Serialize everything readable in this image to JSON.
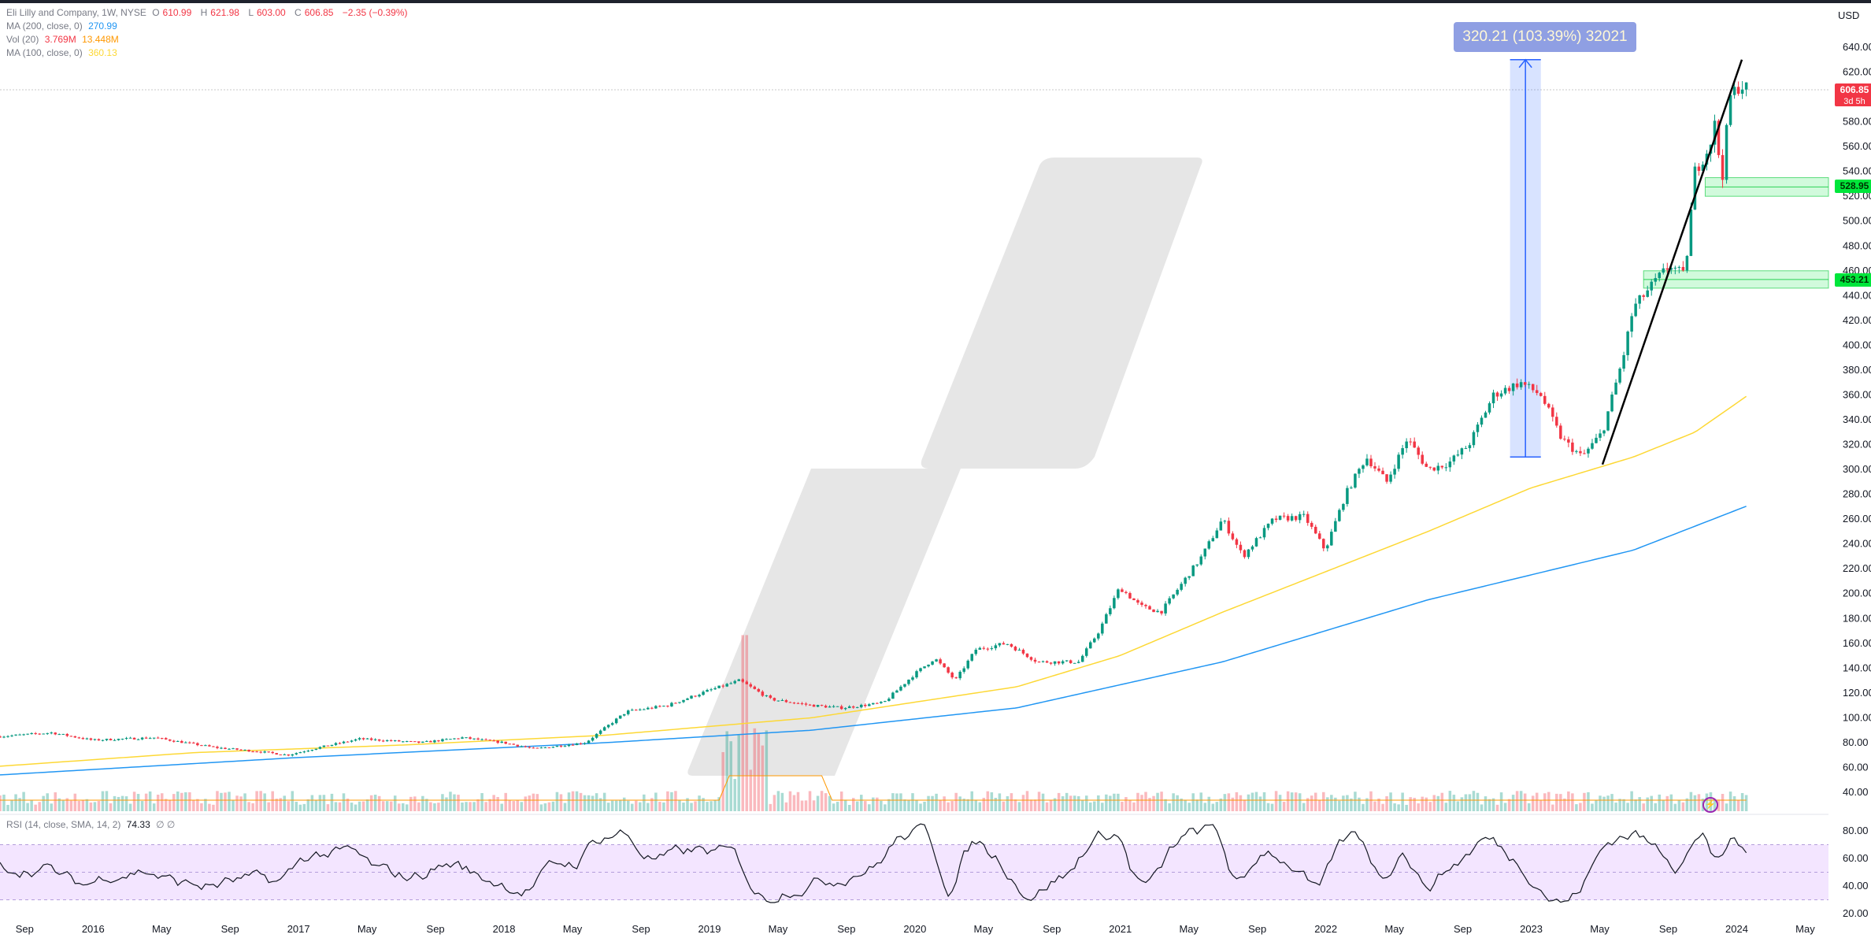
{
  "header": {
    "symbol": "Eli Lilly and Company, 1W, NYSE",
    "open_label": "O",
    "open": "610.99",
    "high_label": "H",
    "high": "621.98",
    "low_label": "L",
    "low": "603.00",
    "close_label": "C",
    "close": "606.85",
    "change": "−2.35 (−0.39%)"
  },
  "indicators": {
    "ma200": {
      "label": "MA (200, close, 0)",
      "value": "270.99",
      "color": "#2196f3"
    },
    "vol": {
      "label": "Vol (20)",
      "value": "3.769M",
      "ma_value": "13.448M"
    },
    "ma100": {
      "label": "MA (100, close, 0)",
      "value": "360.13",
      "color": "#fdd835"
    },
    "rsi": {
      "label": "RSI (14, close, SMA, 14, 2)",
      "value": "74.33",
      "extra": "∅ ∅"
    }
  },
  "currency": "USD",
  "measure": {
    "label": "320.21 (103.39%) 32021"
  },
  "tags": {
    "last": {
      "price": "606.85",
      "countdown": "3d 5h"
    },
    "support1": "528.95",
    "support2": "453.21"
  },
  "chart_data": {
    "type": "candlestick",
    "title": "",
    "price_axis": {
      "ticks": [
        40,
        60,
        80,
        100,
        120,
        140,
        160,
        180,
        200,
        220,
        240,
        260,
        280,
        300,
        320,
        340,
        360,
        380,
        400,
        420,
        440,
        460,
        480,
        500,
        520,
        540,
        560,
        580,
        600,
        620,
        640
      ],
      "range": [
        30,
        650
      ]
    },
    "rsi_axis": {
      "ticks": [
        20,
        40,
        60,
        80
      ],
      "upper_band": 70,
      "lower_band": 30
    },
    "time_axis": {
      "labels": [
        "Sep",
        "2016",
        "May",
        "Sep",
        "2017",
        "May",
        "Sep",
        "2018",
        "May",
        "Sep",
        "2019",
        "May",
        "Sep",
        "2020",
        "May",
        "Sep",
        "2021",
        "May",
        "Sep",
        "2022",
        "May",
        "Sep",
        "2023",
        "May",
        "Sep",
        "2024",
        "May"
      ],
      "range": [
        2015.55,
        2024.45
      ]
    },
    "price_path": [
      [
        2015.55,
        85
      ],
      [
        2015.8,
        88
      ],
      [
        2016.0,
        82
      ],
      [
        2016.3,
        84
      ],
      [
        2016.6,
        76
      ],
      [
        2016.8,
        73
      ],
      [
        2016.95,
        70
      ],
      [
        2017.1,
        76
      ],
      [
        2017.3,
        83
      ],
      [
        2017.6,
        80
      ],
      [
        2017.8,
        84
      ],
      [
        2018.0,
        80
      ],
      [
        2018.15,
        75
      ],
      [
        2018.4,
        80
      ],
      [
        2018.6,
        105
      ],
      [
        2018.8,
        110
      ],
      [
        2019.0,
        122
      ],
      [
        2019.15,
        130
      ],
      [
        2019.3,
        115
      ],
      [
        2019.5,
        110
      ],
      [
        2019.65,
        108
      ],
      [
        2019.85,
        112
      ],
      [
        2020.0,
        135
      ],
      [
        2020.1,
        148
      ],
      [
        2020.2,
        130
      ],
      [
        2020.3,
        155
      ],
      [
        2020.45,
        160
      ],
      [
        2020.6,
        145
      ],
      [
        2020.8,
        145
      ],
      [
        2020.9,
        170
      ],
      [
        2021.0,
        205
      ],
      [
        2021.1,
        190
      ],
      [
        2021.2,
        185
      ],
      [
        2021.4,
        230
      ],
      [
        2021.5,
        260
      ],
      [
        2021.6,
        230
      ],
      [
        2021.75,
        260
      ],
      [
        2021.9,
        262
      ],
      [
        2022.0,
        235
      ],
      [
        2022.1,
        280
      ],
      [
        2022.2,
        310
      ],
      [
        2022.3,
        290
      ],
      [
        2022.4,
        325
      ],
      [
        2022.5,
        300
      ],
      [
        2022.6,
        305
      ],
      [
        2022.7,
        320
      ],
      [
        2022.82,
        360
      ],
      [
        2022.95,
        370
      ],
      [
        2023.05,
        360
      ],
      [
        2023.15,
        325
      ],
      [
        2023.25,
        310
      ],
      [
        2023.35,
        330
      ],
      [
        2023.45,
        390
      ],
      [
        2023.5,
        430
      ],
      [
        2023.6,
        450
      ],
      [
        2023.68,
        465
      ],
      [
        2023.75,
        455
      ],
      [
        2023.8,
        540
      ],
      [
        2023.87,
        560
      ],
      [
        2023.9,
        580
      ],
      [
        2023.93,
        530
      ],
      [
        2023.97,
        600
      ],
      [
        2024.02,
        610
      ],
      [
        2024.06,
        606
      ]
    ],
    "ma200_path": [
      [
        2015.55,
        54
      ],
      [
        2017.0,
        68
      ],
      [
        2018.5,
        80
      ],
      [
        2019.5,
        90
      ],
      [
        2020.5,
        108
      ],
      [
        2021.5,
        145
      ],
      [
        2022.5,
        195
      ],
      [
        2023.5,
        235
      ],
      [
        2024.06,
        271
      ]
    ],
    "ma100_path": [
      [
        2015.55,
        61
      ],
      [
        2016.5,
        72
      ],
      [
        2017.5,
        78
      ],
      [
        2018.5,
        86
      ],
      [
        2019.5,
        100
      ],
      [
        2020.5,
        125
      ],
      [
        2021.0,
        150
      ],
      [
        2021.5,
        185
      ],
      [
        2022.5,
        250
      ],
      [
        2023.0,
        285
      ],
      [
        2023.5,
        310
      ],
      [
        2023.8,
        330
      ],
      [
        2024.06,
        360
      ]
    ],
    "trendline": [
      [
        2023.35,
        304
      ],
      [
        2024.45,
        630
      ]
    ],
    "support_zones": [
      {
        "from": 2023.85,
        "low": 520,
        "high": 535,
        "label": "528.95"
      },
      {
        "from": 2023.55,
        "low": 446,
        "high": 460,
        "label": "453.21"
      }
    ],
    "measure_range": {
      "x_from": 2022.9,
      "x_to": 2023.05,
      "low": 310,
      "high": 630
    },
    "volume_spike": {
      "x": 2019.17,
      "value_relative": 0.86
    }
  }
}
